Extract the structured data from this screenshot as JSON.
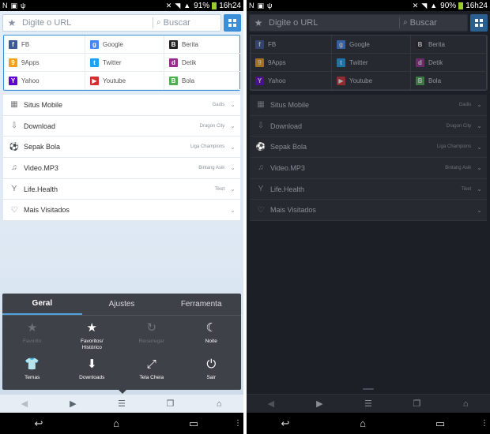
{
  "status_left": {
    "battery": "91%",
    "time": "16h24"
  },
  "status_right": {
    "battery": "90%",
    "time": "16h24"
  },
  "urlbar": {
    "placeholder": "Digite o URL",
    "search": "Buscar",
    "star_icon": "bookmark-star-icon",
    "menu_icon": "grid-menu-icon"
  },
  "quick_links": [
    {
      "label": "FB",
      "icon": "facebook-icon",
      "color": "#3b5998",
      "glyph": "f"
    },
    {
      "label": "Google",
      "icon": "google-icon",
      "color": "#4285f4",
      "glyph": "g"
    },
    {
      "label": "Berita",
      "icon": "berita-icon",
      "color": "#222222",
      "glyph": "B"
    },
    {
      "label": "9Apps",
      "icon": "9apps-icon",
      "color": "#f2a11d",
      "glyph": "9"
    },
    {
      "label": "Twitter",
      "icon": "twitter-icon",
      "color": "#1da1f2",
      "glyph": "t"
    },
    {
      "label": "Detik",
      "icon": "detik-icon",
      "color": "#9b2c8f",
      "glyph": "d"
    },
    {
      "label": "Yahoo",
      "icon": "yahoo-icon",
      "color": "#5f01d1",
      "glyph": "Y"
    },
    {
      "label": "Youtube",
      "icon": "youtube-icon",
      "color": "#d32f2f",
      "glyph": "▶"
    },
    {
      "label": "Bola",
      "icon": "bola-icon",
      "color": "#4caf50",
      "glyph": "B"
    }
  ],
  "categories": [
    {
      "name": "Situs Mobile",
      "sub": "Gadis",
      "icon": "grid-icon",
      "glyph": "▦"
    },
    {
      "name": "Download",
      "sub": "Dragon City",
      "icon": "download-icon",
      "glyph": "⇩"
    },
    {
      "name": "Sepak Bola",
      "sub": "Liga Champions",
      "icon": "soccer-ball-icon",
      "glyph": "⚽"
    },
    {
      "name": "Video.MP3",
      "sub": "Bintang Asik",
      "icon": "music-note-icon",
      "glyph": "♫"
    },
    {
      "name": "Life.Health",
      "sub": "Tiket",
      "icon": "cocktail-icon",
      "glyph": "Y"
    },
    {
      "name": "Mais Visitados",
      "sub": "",
      "icon": "heart-icon",
      "glyph": "♡"
    }
  ],
  "menu": {
    "tabs": [
      "Geral",
      "Ajustes",
      "Ferramenta"
    ],
    "active_tab": 0,
    "items": [
      {
        "label": "Favorito",
        "icon": "star-add-icon",
        "glyph": "★",
        "enabled": false
      },
      {
        "label": "Favoritos/\nHistórico",
        "icon": "star-list-icon",
        "glyph": "★",
        "enabled": true
      },
      {
        "label": "Recarregar",
        "icon": "refresh-icon",
        "glyph": "↻",
        "enabled": false
      },
      {
        "label": "Noite",
        "icon": "moon-icon",
        "glyph": "☾",
        "enabled": true
      },
      {
        "label": "Temas",
        "icon": "tshirt-icon",
        "glyph": "👕",
        "enabled": true
      },
      {
        "label": "Downloads",
        "icon": "download-tray-icon",
        "glyph": "⬇",
        "enabled": true
      },
      {
        "label": "Tela Cheia",
        "icon": "fullscreen-icon",
        "glyph": "⤢",
        "enabled": true
      },
      {
        "label": "Sair",
        "icon": "power-icon",
        "glyph": "⏻",
        "enabled": true
      }
    ]
  },
  "toolbar": [
    "back-icon",
    "forward-icon",
    "menu-list-icon",
    "tabs-icon",
    "home-icon"
  ],
  "navbar": [
    "nav-back-icon",
    "nav-home-icon",
    "nav-recents-icon",
    "nav-more-icon"
  ]
}
